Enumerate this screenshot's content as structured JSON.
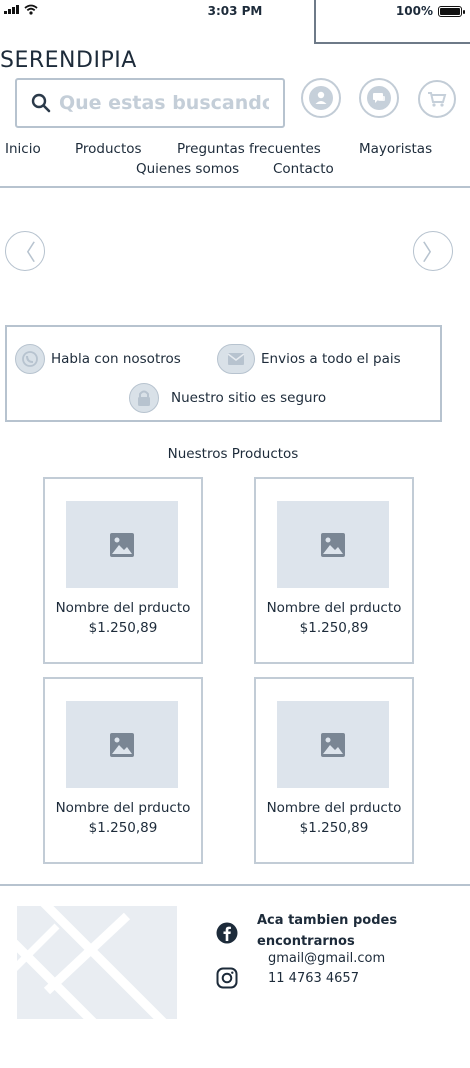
{
  "status_bar": {
    "time": "3:03 PM",
    "battery": "100%"
  },
  "brand": "SERENDIPIA",
  "search": {
    "placeholder": "Que estas buscando?"
  },
  "header_icons": [
    "user-icon",
    "chat-icon",
    "cart-icon"
  ],
  "nav": {
    "items": [
      "Inicio",
      "Productos",
      "Preguntas frecuentes",
      "Mayoristas",
      "Quienes somos",
      "Contacto"
    ]
  },
  "carousel": {
    "prev": "〈",
    "next": "〉"
  },
  "features": [
    {
      "label": "Habla con nosotros",
      "icon": "whatsapp-icon"
    },
    {
      "label": "Envios a todo el pais",
      "icon": "mail-icon"
    },
    {
      "label": "Nuestro sitio es seguro",
      "icon": "lock-icon"
    }
  ],
  "products": {
    "title": "Nuestros Productos",
    "items": [
      {
        "name": "Nombre del prducto",
        "price": "$1.250,89"
      },
      {
        "name": "Nombre del prducto",
        "price": "$1.250,89"
      },
      {
        "name": "Nombre del prducto",
        "price": "$1.250,89"
      },
      {
        "name": "Nombre del prducto",
        "price": "$1.250,89"
      }
    ]
  },
  "footer": {
    "title": "Aca tambien podes encontrarnos",
    "email": "gmail@gmail.com",
    "phone": "11 4763 4657",
    "social": [
      "facebook-icon",
      "instagram-icon"
    ]
  },
  "colors": {
    "border": "#b7c3cf",
    "placeholder_fill": "#dde4ec",
    "text": "#1d2b3a"
  }
}
